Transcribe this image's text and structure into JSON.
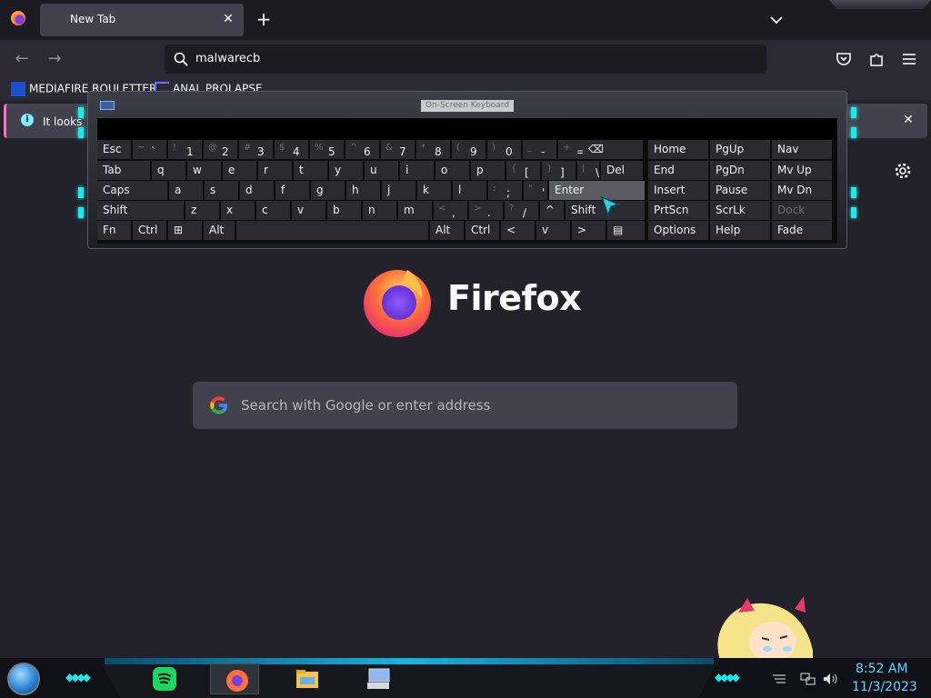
{
  "browser": {
    "tab": {
      "title": "New Tab",
      "close": "✕"
    },
    "new_tab": "+",
    "urlbar": {
      "value": "malwarecb"
    },
    "bookmarks": [
      {
        "label": "MEDIAFIRE ROULETTER",
        "icon": "mediafire-icon"
      },
      {
        "label": "ANAL PROLAPSE",
        "icon": "bookmark-icon"
      }
    ],
    "notification": {
      "text": "It looks",
      "close": "✕"
    },
    "brand": "Firefox",
    "search": {
      "placeholder": "Search with Google or enter address"
    }
  },
  "osk": {
    "title": "On-Screen Keyboard",
    "rows": [
      [
        {
          "label": "Esc"
        },
        {
          "shift": "~",
          "label": "`"
        },
        {
          "shift": "!",
          "label": "1"
        },
        {
          "shift": "@",
          "label": "2"
        },
        {
          "shift": "#",
          "label": "3"
        },
        {
          "shift": "$",
          "label": "4"
        },
        {
          "shift": "%",
          "label": "5"
        },
        {
          "shift": "^",
          "label": "6"
        },
        {
          "shift": "&",
          "label": "7"
        },
        {
          "shift": "*",
          "label": "8"
        },
        {
          "shift": "(",
          "label": "9"
        },
        {
          "shift": ")",
          "label": "0"
        },
        {
          "shift": "_",
          "label": "-"
        },
        {
          "shift": "+",
          "label": "="
        },
        {
          "label": "⌫"
        },
        {
          "label": "Home"
        },
        {
          "label": "PgUp"
        },
        {
          "label": "Nav"
        }
      ],
      [
        {
          "label": "Tab"
        },
        {
          "label": "q"
        },
        {
          "label": "w"
        },
        {
          "label": "e"
        },
        {
          "label": "r"
        },
        {
          "label": "t"
        },
        {
          "label": "y"
        },
        {
          "label": "u"
        },
        {
          "label": "i"
        },
        {
          "label": "o"
        },
        {
          "label": "p"
        },
        {
          "shift": "{",
          "label": "["
        },
        {
          "shift": "}",
          "label": "]"
        },
        {
          "shift": "|",
          "label": "\\"
        },
        {
          "label": "Del"
        },
        {
          "label": "End"
        },
        {
          "label": "PgDn"
        },
        {
          "label": "Mv Up"
        }
      ],
      [
        {
          "label": "Caps"
        },
        {
          "label": "a"
        },
        {
          "label": "s"
        },
        {
          "label": "d"
        },
        {
          "label": "f"
        },
        {
          "label": "g"
        },
        {
          "label": "h"
        },
        {
          "label": "j"
        },
        {
          "label": "k"
        },
        {
          "label": "l"
        },
        {
          "shift": ":",
          "label": ";"
        },
        {
          "shift": "\"",
          "label": "'"
        },
        {
          "label": "Enter"
        },
        {
          "label": "Insert"
        },
        {
          "label": "Pause"
        },
        {
          "label": "Mv Dn"
        }
      ],
      [
        {
          "label": "Shift"
        },
        {
          "label": "z"
        },
        {
          "label": "x"
        },
        {
          "label": "c"
        },
        {
          "label": "v"
        },
        {
          "label": "b"
        },
        {
          "label": "n"
        },
        {
          "label": "m"
        },
        {
          "shift": "<",
          "label": ","
        },
        {
          "shift": ">",
          "label": "."
        },
        {
          "shift": "?",
          "label": "/"
        },
        {
          "label": "^"
        },
        {
          "label": "Shift"
        },
        {
          "label": "PrtScn"
        },
        {
          "label": "ScrLk"
        },
        {
          "label": "Dock"
        }
      ],
      [
        {
          "label": "Fn"
        },
        {
          "label": "Ctrl"
        },
        {
          "label": "⊞"
        },
        {
          "label": "Alt"
        },
        {
          "label": ""
        },
        {
          "label": "Alt"
        },
        {
          "label": "Ctrl"
        },
        {
          "label": "<"
        },
        {
          "label": "v"
        },
        {
          "label": ">"
        },
        {
          "label": "▤"
        },
        {
          "label": "Options"
        },
        {
          "label": "Help"
        },
        {
          "label": "Fade"
        }
      ]
    ]
  },
  "taskbar": {
    "time": "8:52 AM",
    "date": "11/3/2023",
    "apps": [
      "spotify-icon",
      "firefox-icon",
      "file-explorer-icon",
      "on-screen-keyboard-icon"
    ]
  }
}
